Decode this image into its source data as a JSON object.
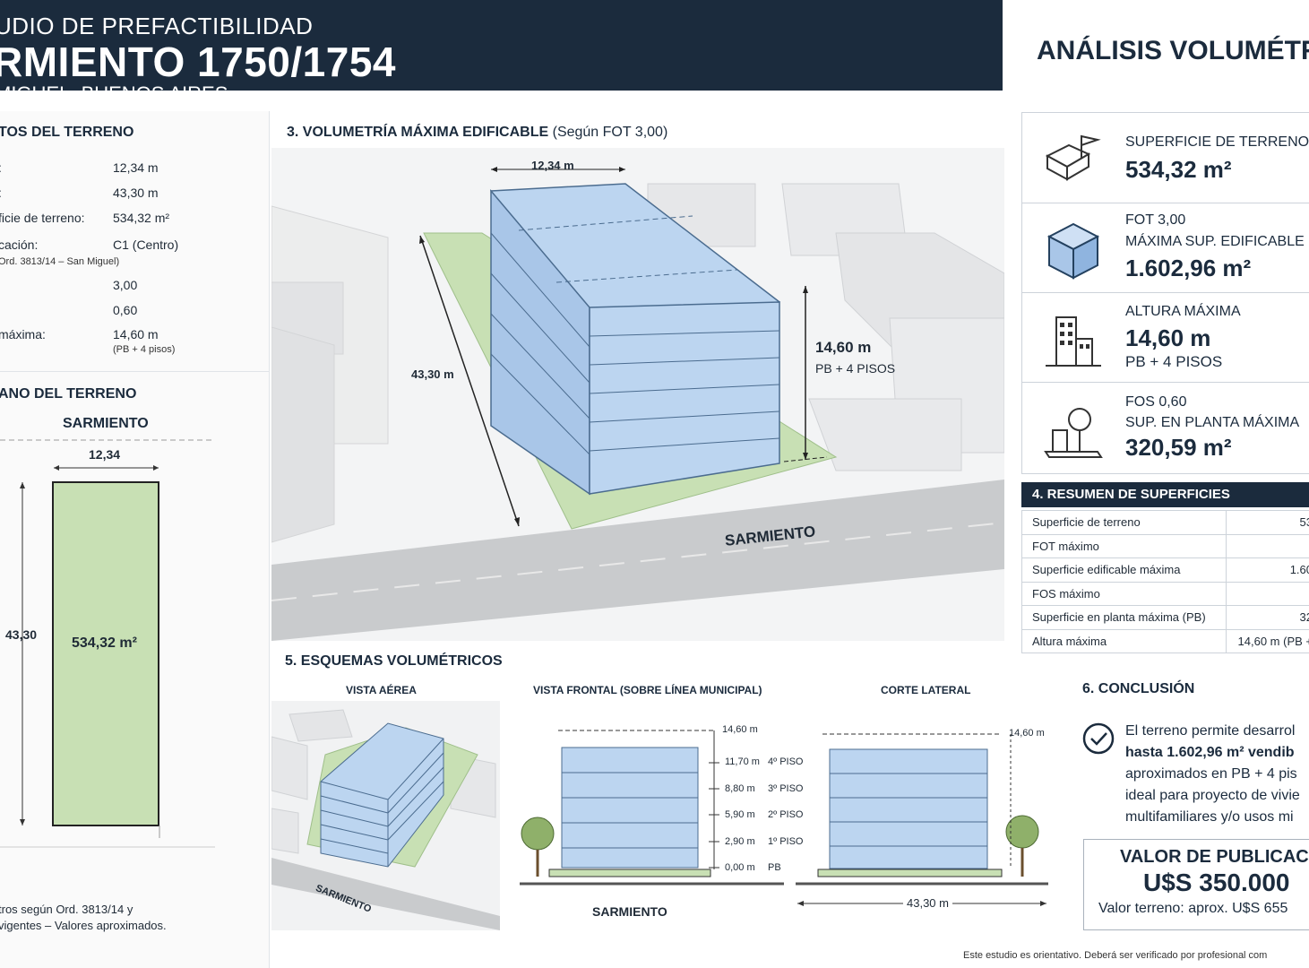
{
  "header": {
    "supertitle": "UDIO DE PREFACTIBILIDAD",
    "title": "RMIENTO 1750/1754",
    "location": "MIGUEL, BUENOS AIRES"
  },
  "right_title": "ANÁLISIS VOLUMÉTRI",
  "left_data": {
    "title": "TOS DEL TERRENO",
    "rows": [
      {
        "label": ":",
        "value": "12,34 m"
      },
      {
        "label": ":",
        "value": "43,30 m"
      },
      {
        "label": "ficie de terreno:",
        "value": "534,32 m²"
      },
      {
        "label": "cación:",
        "value": "C1 (Centro)"
      },
      {
        "label": "Ord. 3813/14 – San Miguel)",
        "value": ""
      },
      {
        "label": "",
        "value": "3,00"
      },
      {
        "label": "",
        "value": "0,60"
      },
      {
        "label": "máxima:",
        "value": "14,60 m"
      }
    ],
    "height_note": "(PB + 4 pisos)"
  },
  "plan": {
    "title": "ANO DEL TERRENO",
    "street": "SARMIENTO",
    "width": "12,34",
    "depth": "43,30",
    "area": "534,32 m²",
    "note1": "tros según Ord. 3813/14 y",
    "note2": "vigentes – Valores aproximados."
  },
  "volumetry": {
    "title": "3. VOLUMETRÍA MÁXIMA EDIFICABLE",
    "subtitle": "(Según FOT 3,00)",
    "width": "12,34 m",
    "depth": "43,30 m",
    "height": "14,60 m",
    "height_sub": "PB + 4 PISOS",
    "street": "SARMIENTO"
  },
  "kpis": [
    {
      "label": "SUPERFICIE DE TERRENO",
      "value": "534,32 m²"
    },
    {
      "label": "FOT 3,00",
      "label2": "MÁXIMA SUP. EDIFICABLE",
      "value": "1.602,96 m²"
    },
    {
      "label": "ALTURA MÁXIMA",
      "value": "14,60 m",
      "sub": "PB + 4 PISOS"
    },
    {
      "label": "FOS 0,60",
      "label2": "SUP. EN PLANTA MÁXIMA",
      "value": "320,59 m²"
    }
  ],
  "summary": {
    "title": "4. RESUMEN DE SUPERFICIES",
    "rows": [
      {
        "label": "Superficie de terreno",
        "value": "53"
      },
      {
        "label": "FOT máximo",
        "value": ""
      },
      {
        "label": "Superficie edificable máxima",
        "value": "1.60"
      },
      {
        "label": "FOS máximo",
        "value": ""
      },
      {
        "label": "Superficie en planta máxima (PB)",
        "value": "32"
      },
      {
        "label": "Altura máxima",
        "value": "14,60 m (PB +"
      }
    ]
  },
  "schemes": {
    "title": "5. ESQUEMAS VOLUMÉTRICOS",
    "aerial": "VISTA AÉREA",
    "frontal": "VISTA FRONTAL (SOBRE LÍNEA MUNICIPAL)",
    "lateral": "CORTE LATERAL",
    "street": "SARMIENTO",
    "aerial_street": "SARMIENTO",
    "levels": [
      {
        "height": "14,60 m",
        "name": ""
      },
      {
        "height": "11,70 m",
        "name": "4º PISO"
      },
      {
        "height": "8,80 m",
        "name": "3º PISO"
      },
      {
        "height": "5,90 m",
        "name": "2º PISO"
      },
      {
        "height": "2,90 m",
        "name": "1º PISO"
      },
      {
        "height": "0,00 m",
        "name": "PB"
      }
    ],
    "lateral_height": "14,60 m",
    "lateral_depth": "43,30 m"
  },
  "conclusion": {
    "title": "6. CONCLUSIÓN",
    "line1": "El terreno permite desarrol",
    "line2": "hasta 1.602,96 m² vendib",
    "line3": "aproximados en PB + 4 pis",
    "line4": "ideal para proyecto de vivie",
    "line5": "multifamiliares y/o usos mi"
  },
  "publication": {
    "label": "VALOR DE PUBLICACIÓN",
    "value": "U$S 350.000",
    "land_value": "Valor terreno: aprox. U$S 655"
  },
  "footer": "Este estudio es orientativo. Deberá ser verificado por profesional com",
  "colors": {
    "navy": "#1b2b3d",
    "building": "#bcd5f0",
    "lot": "#c8e0b4"
  }
}
